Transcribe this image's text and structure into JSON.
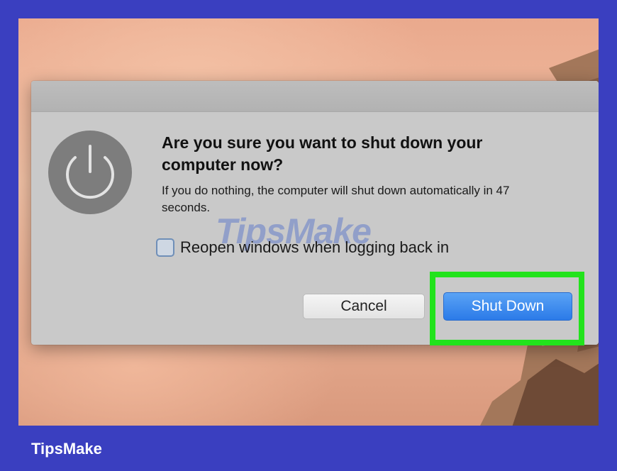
{
  "dialog": {
    "icon": "power-icon",
    "headline": "Are you sure you want to shut down your computer now?",
    "message": "If you do nothing, the computer will shut down automatically in 47 seconds.",
    "countdown_seconds": 47,
    "checkbox": {
      "label": "Reopen windows when logging back in",
      "checked": false
    },
    "cancel_label": "Cancel",
    "shutdown_label": "Shut Down"
  },
  "watermark": "TipsMake",
  "brand": "TipsMake",
  "colors": {
    "frame": "#3a3fc0",
    "highlight": "#22e31c",
    "primary_button": "#2b7ae8",
    "dialog": "#c9c9c9"
  }
}
